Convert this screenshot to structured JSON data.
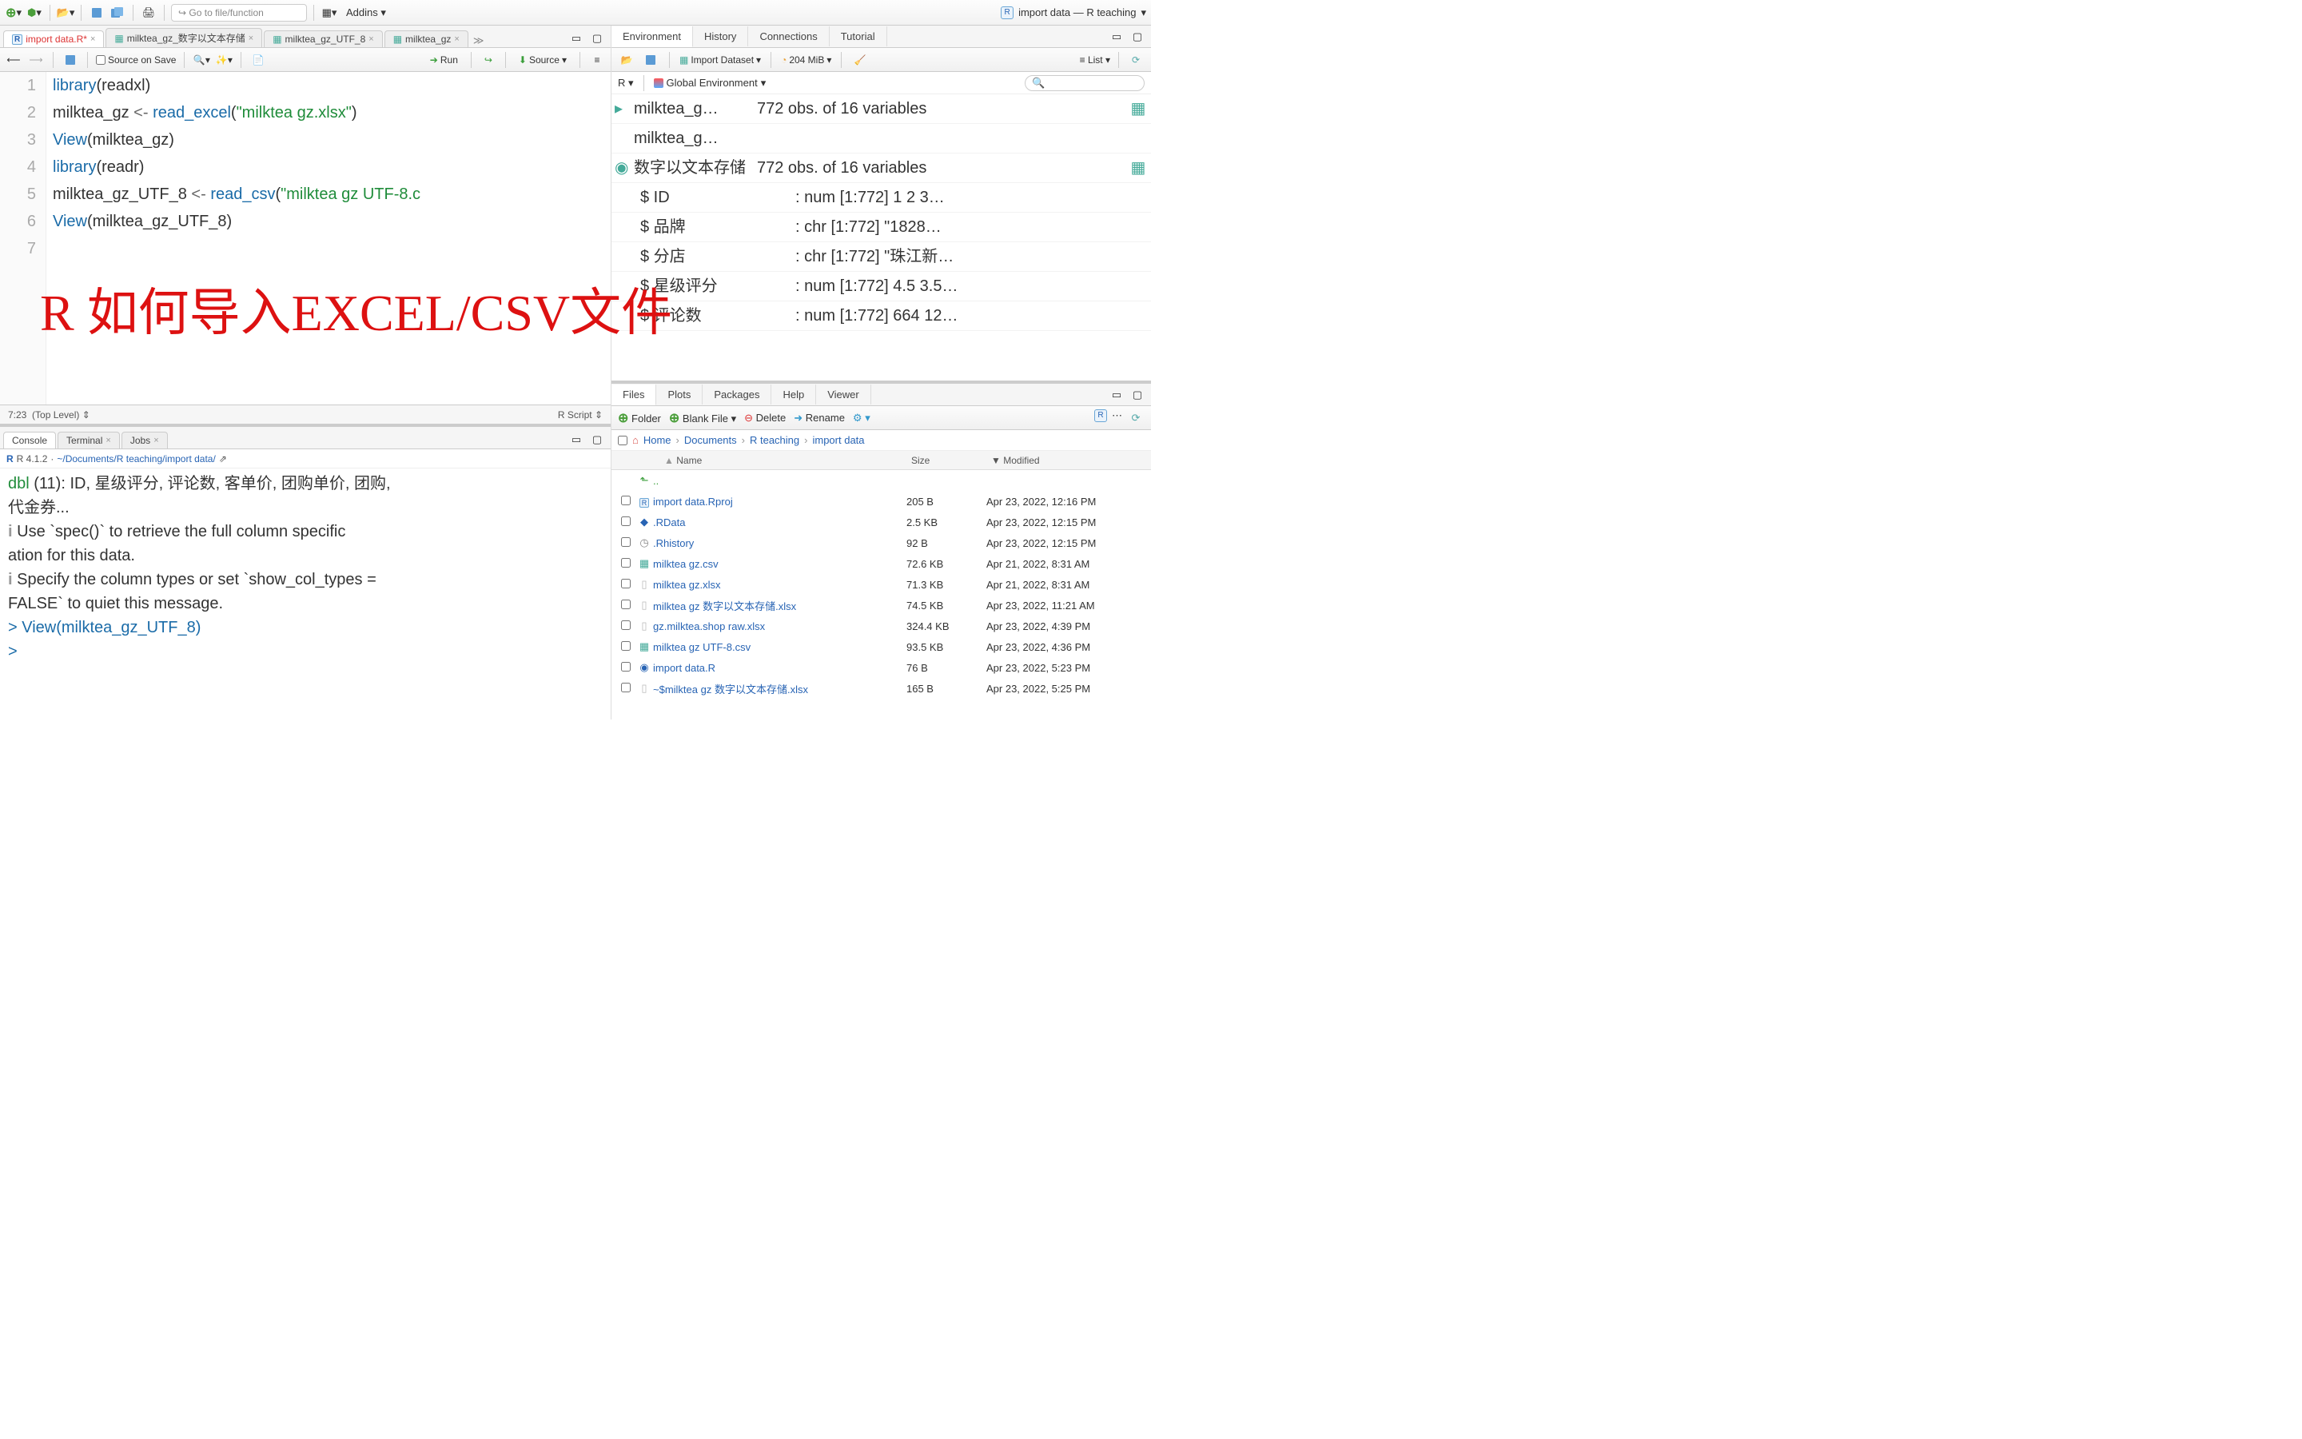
{
  "top": {
    "goto_placeholder": "Go to file/function",
    "addins": "Addins",
    "project": "import data — R teaching"
  },
  "source": {
    "tabs": [
      {
        "label": "import data.R*",
        "modified": true
      },
      {
        "label": "milktea_gz_数字以文本存储"
      },
      {
        "label": "milktea_gz_UTF_8"
      },
      {
        "label": "milktea_gz"
      }
    ],
    "source_on_save": "Source on Save",
    "run": "Run",
    "source_btn": "Source",
    "cursor": "7:23",
    "scope": "(Top Level)",
    "lang": "R Script",
    "lines": [
      {
        "n": 1,
        "html": "<span class='fn'>library</span>(readxl)"
      },
      {
        "n": 2,
        "html": "milktea_gz <span class='op'>&lt;-</span> <span class='fn'>read_excel</span>(<span class='str'>\"milktea gz.xlsx\"</span>)"
      },
      {
        "n": 3,
        "html": "<span class='fn'>View</span>(milktea_gz)"
      },
      {
        "n": 4,
        "html": ""
      },
      {
        "n": 5,
        "html": "<span class='fn'>library</span>(readr)"
      },
      {
        "n": 6,
        "html": "milktea_gz_UTF_8 <span class='op'>&lt;-</span> <span class='fn'>read_csv</span>(<span class='str'>\"milktea gz UTF-8.c</span>"
      },
      {
        "n": 7,
        "html": "<span class='fn'>View</span>(milktea_gz_UTF_8)"
      }
    ],
    "overlay": "R 如何导入EXCEL/CSV文件"
  },
  "console": {
    "tabs": [
      "Console",
      "Terminal",
      "Jobs"
    ],
    "version": "R 4.1.2",
    "path": "~/Documents/R teaching/import data/",
    "body_lines": [
      "<span class='kw'>dbl</span> (11): ID, 星级评分, 评论数, 客单价, 团购单价, 团购,",
      " 代金券...",
      "",
      "<span class='info'>i</span> Use `spec()` to retrieve the full column specific",
      "ation for this data.",
      "<span class='info'>i</span> Specify the column types or set `show_col_types =",
      " FALSE` to quiet this message.",
      "<span class='prompt'>&gt;</span> <span class='prompt'>View(milktea_gz_UTF_8)</span>",
      "<span class='prompt'>&gt;</span> "
    ]
  },
  "env": {
    "tabs": [
      "Environment",
      "History",
      "Connections",
      "Tutorial"
    ],
    "import_dataset": "Import Dataset",
    "mem": "204 MiB",
    "list_label": "List",
    "lang": "R",
    "scope": "Global Environment",
    "vars": [
      {
        "name": "milktea_g…",
        "val": "772 obs. of 16 variables",
        "grid": true,
        "expand": "closed"
      },
      {
        "name": "milktea_g…",
        "val": "",
        "grid": false
      },
      {
        "name": "数字以文本存储",
        "val": "772 obs. of 16 variables",
        "grid": true,
        "expand": "open"
      }
    ],
    "details": [
      {
        "k": "$ ID",
        "v": ": num [1:772] 1 2 3…"
      },
      {
        "k": "$ 品牌",
        "v": ": chr [1:772] \"1828…"
      },
      {
        "k": "$ 分店",
        "v": ": chr [1:772] \"珠江新…"
      },
      {
        "k": "$ 星级评分",
        "v": ": num [1:772] 4.5 3.5…"
      },
      {
        "k": "$ 评论数",
        "v": ": num [1:772] 664 12…"
      }
    ]
  },
  "files": {
    "tabs": [
      "Files",
      "Plots",
      "Packages",
      "Help",
      "Viewer"
    ],
    "new_folder": "Folder",
    "blank_file": "Blank File",
    "delete": "Delete",
    "rename": "Rename",
    "breadcrumb": [
      "Home",
      "Documents",
      "R teaching",
      "import data"
    ],
    "cols": {
      "name": "Name",
      "size": "Size",
      "mod": "Modified"
    },
    "up": "..",
    "rows": [
      {
        "name": "import data.Rproj",
        "size": "205 B",
        "mod": "Apr 23, 2022, 12:16 PM",
        "icon": "rproj"
      },
      {
        "name": ".RData",
        "size": "2.5 KB",
        "mod": "Apr 23, 2022, 12:15 PM",
        "icon": "rdata"
      },
      {
        "name": ".Rhistory",
        "size": "92 B",
        "mod": "Apr 23, 2022, 12:15 PM",
        "icon": "hist"
      },
      {
        "name": "milktea gz.csv",
        "size": "72.6 KB",
        "mod": "Apr 21, 2022, 8:31 AM",
        "icon": "csv"
      },
      {
        "name": "milktea gz.xlsx",
        "size": "71.3 KB",
        "mod": "Apr 21, 2022, 8:31 AM",
        "icon": "file"
      },
      {
        "name": "milktea gz 数字以文本存储.xlsx",
        "size": "74.5 KB",
        "mod": "Apr 23, 2022, 11:21 AM",
        "icon": "file"
      },
      {
        "name": "gz.milktea.shop raw.xlsx",
        "size": "324.4 KB",
        "mod": "Apr 23, 2022, 4:39 PM",
        "icon": "file"
      },
      {
        "name": "milktea gz UTF-8.csv",
        "size": "93.5 KB",
        "mod": "Apr 23, 2022, 4:36 PM",
        "icon": "csv"
      },
      {
        "name": "import data.R",
        "size": "76 B",
        "mod": "Apr 23, 2022, 5:23 PM",
        "icon": "r"
      },
      {
        "name": "~$milktea gz 数字以文本存储.xlsx",
        "size": "165 B",
        "mod": "Apr 23, 2022, 5:25 PM",
        "icon": "file"
      }
    ]
  }
}
